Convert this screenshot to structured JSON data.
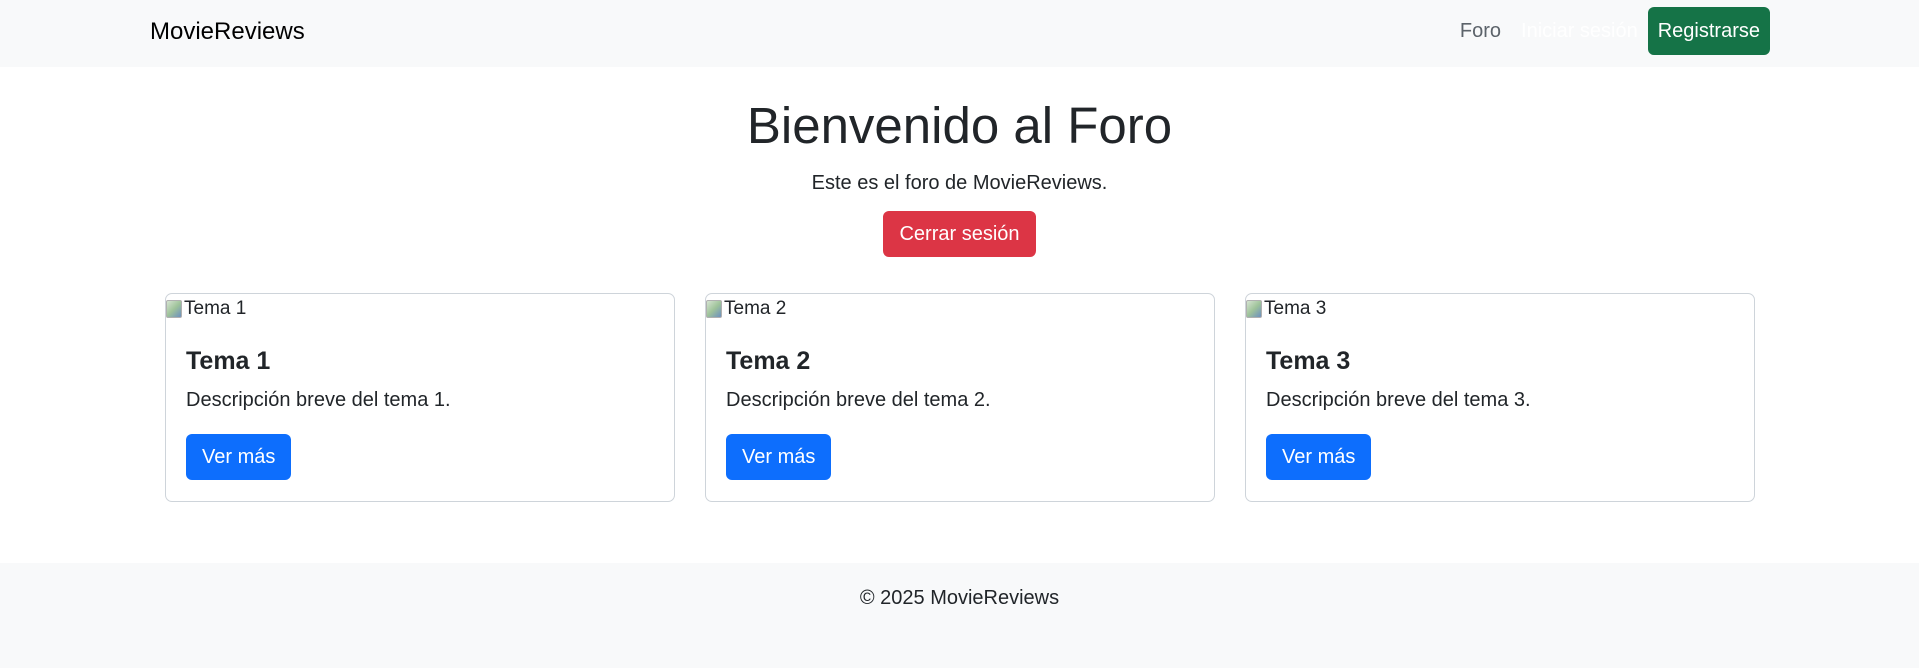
{
  "navbar": {
    "brand": "MovieReviews",
    "links": {
      "foro": "Foro",
      "login": "Iniciar sesión",
      "register": "Registrarse"
    }
  },
  "hero": {
    "title": "Bienvenido al Foro",
    "subtitle": "Este es el foro de MovieReviews.",
    "logout_label": "Cerrar sesión"
  },
  "cards": [
    {
      "image_alt": "Tema 1",
      "title": "Tema 1",
      "description": "Descripción breve del tema 1.",
      "button": "Ver más"
    },
    {
      "image_alt": "Tema 2",
      "title": "Tema 2",
      "description": "Descripción breve del tema 2.",
      "button": "Ver más"
    },
    {
      "image_alt": "Tema 3",
      "title": "Tema 3",
      "description": "Descripción breve del tema 3.",
      "button": "Ver más"
    }
  ],
  "footer": {
    "text": "© 2025 MovieReviews"
  },
  "colors": {
    "navbar_bg": "#f8f9fa",
    "register": "#157347",
    "logout": "#dc3545",
    "primary": "#0d6efd"
  },
  "icons": {
    "card_image": "broken-image-icon"
  }
}
